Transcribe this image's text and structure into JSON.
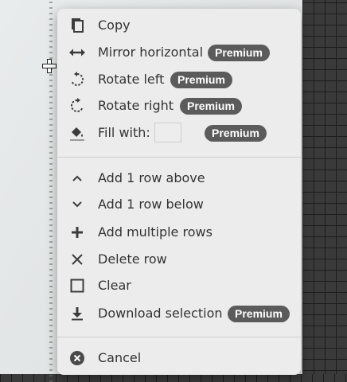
{
  "menu": {
    "copy": {
      "label": "Copy",
      "icon": "copy-icon"
    },
    "mirror_horizontal": {
      "label": "Mirror horizontal",
      "badge": "Premium",
      "icon": "mirror-horizontal-icon"
    },
    "rotate_left": {
      "label": "Rotate left",
      "badge": "Premium",
      "icon": "rotate-left-icon"
    },
    "rotate_right": {
      "label": "Rotate right",
      "badge": "Premium",
      "icon": "rotate-right-icon"
    },
    "fill_with": {
      "label": "Fill with:",
      "badge": "Premium",
      "icon": "paint-bucket-icon"
    },
    "add_row_above": {
      "label": "Add 1 row above",
      "icon": "chevron-up-icon"
    },
    "add_row_below": {
      "label": "Add 1 row below",
      "icon": "chevron-down-icon"
    },
    "add_multiple_rows": {
      "label": "Add multiple rows",
      "icon": "plus-icon"
    },
    "delete_row": {
      "label": "Delete row",
      "icon": "x-icon"
    },
    "clear": {
      "label": "Clear",
      "icon": "square-icon"
    },
    "download_selection": {
      "label": "Download selection",
      "badge": "Premium",
      "icon": "download-icon"
    },
    "cancel": {
      "label": "Cancel",
      "icon": "cancel-circle-icon"
    }
  },
  "colors": {
    "menu_bg": "#ececec",
    "badge_bg": "#5b5b5b",
    "text": "#333333"
  }
}
